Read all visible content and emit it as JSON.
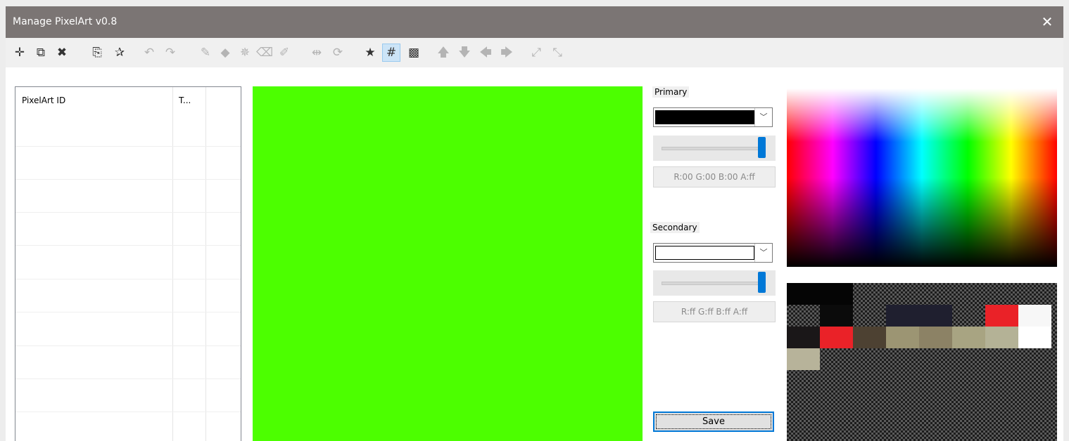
{
  "window": {
    "title": "Manage PixelArt v0.8",
    "close_glyph": "✕"
  },
  "toolbar": {
    "buttons": [
      {
        "name": "add-icon",
        "glyph": "✛",
        "state": "normal"
      },
      {
        "name": "copy-icon",
        "glyph": "⧉",
        "state": "normal"
      },
      {
        "name": "delete-icon",
        "glyph": "✖",
        "state": "normal"
      },
      {
        "name": "export-icon",
        "glyph": "⎘",
        "state": "normal"
      },
      {
        "name": "new-star-icon",
        "glyph": "✰",
        "state": "normal"
      },
      {
        "name": "undo-icon",
        "glyph": "↶",
        "state": "dim"
      },
      {
        "name": "redo-icon",
        "glyph": "↷",
        "state": "dim"
      },
      {
        "name": "pencil-icon",
        "glyph": "✎",
        "state": "dim"
      },
      {
        "name": "fill-icon",
        "glyph": "◆",
        "state": "dim"
      },
      {
        "name": "spray-icon",
        "glyph": "✵",
        "state": "dim"
      },
      {
        "name": "eraser-icon",
        "glyph": "⌫",
        "state": "dim"
      },
      {
        "name": "eyedropper-icon",
        "glyph": "✐",
        "state": "dim"
      },
      {
        "name": "flip-icon",
        "glyph": "⇹",
        "state": "dim"
      },
      {
        "name": "rotate-icon",
        "glyph": "⟳",
        "state": "dim"
      },
      {
        "name": "star-icon",
        "glyph": "★",
        "state": "normal"
      },
      {
        "name": "grid-icon",
        "glyph": "#",
        "state": "selected"
      },
      {
        "name": "transparency-icon",
        "glyph": "▩",
        "state": "normal"
      },
      {
        "name": "arrow-up-icon",
        "glyph": "🡅",
        "state": "dim"
      },
      {
        "name": "arrow-down-icon",
        "glyph": "🡇",
        "state": "dim"
      },
      {
        "name": "arrow-left-icon",
        "glyph": "🡄",
        "state": "dim"
      },
      {
        "name": "arrow-right-icon",
        "glyph": "🡆",
        "state": "dim"
      },
      {
        "name": "expand-icon",
        "glyph": "⤢",
        "state": "dim"
      },
      {
        "name": "shrink-icon",
        "glyph": "⤡",
        "state": "dim"
      }
    ]
  },
  "list": {
    "columns": [
      "PixelArt ID",
      "T..."
    ],
    "rows": []
  },
  "primary": {
    "label": "Primary",
    "swatch_color": "#000000",
    "alpha_value": 1.0,
    "rgba_text": "R:00 G:00 B:00 A:ff"
  },
  "secondary": {
    "label": "Secondary",
    "swatch_color": "#ffffff",
    "alpha_value": 1.0,
    "rgba_text": "R:ff G:ff B:ff A:ff"
  },
  "save_label": "Save",
  "canvas_color": "#4cff00",
  "palette": {
    "columns": 8,
    "cells": [
      "#050505",
      "#050505",
      "",
      "",
      "",
      "",
      "",
      "",
      "",
      "#0b0b0b",
      "",
      "#1f1f2f",
      "#1f1f2f",
      "",
      "#ea2228",
      "#f7f7f7",
      "#1a1718",
      "#ea2228",
      "#4d4132",
      "#9c9573",
      "#8c8265",
      "#a8a482",
      "#b4b296",
      "#ffffff",
      "#b7b39a",
      "",
      "",
      "",
      "",
      "",
      "",
      ""
    ]
  },
  "colors": {
    "titlebar": "#7b7574",
    "accent": "#0078d7"
  }
}
